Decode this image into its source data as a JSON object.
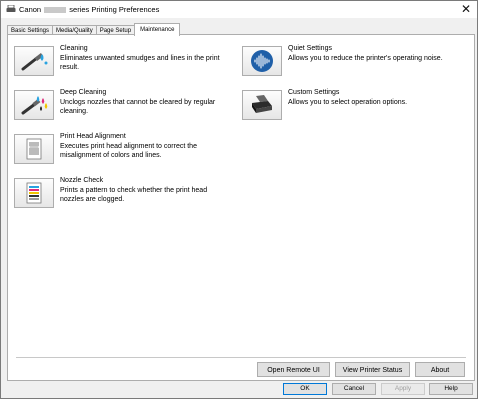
{
  "window": {
    "title_prefix": "Canon",
    "title_suffix": "series Printing Preferences",
    "close_glyph": "✕"
  },
  "tabs": [
    {
      "label": "Basic Settings"
    },
    {
      "label": "Media/Quality"
    },
    {
      "label": "Page Setup"
    },
    {
      "label": "Maintenance"
    }
  ],
  "maintenance": {
    "cleaning": {
      "title": "Cleaning",
      "description": "Eliminates unwanted smudges and lines in the print result."
    },
    "deep_cleaning": {
      "title": "Deep Cleaning",
      "description": "Unclogs nozzles that cannot be cleared by regular cleaning."
    },
    "print_head_alignment": {
      "title": "Print Head Alignment",
      "description": "Executes print head alignment to correct the misalignment of colors and lines."
    },
    "nozzle_check": {
      "title": "Nozzle Check",
      "description": "Prints a pattern to check whether the print head nozzles are clogged."
    },
    "quiet_settings": {
      "title": "Quiet Settings",
      "description": "Allows you to reduce the printer's operating noise."
    },
    "custom_settings": {
      "title": "Custom Settings",
      "description": "Allows you to select operation options."
    }
  },
  "panel_buttons": {
    "open_remote_ui": "Open Remote UI",
    "view_printer_status": "View Printer Status",
    "about": "About"
  },
  "dialog_buttons": {
    "ok": "OK",
    "cancel": "Cancel",
    "apply": "Apply",
    "help": "Help"
  },
  "colors": {
    "accent": "#0078d7",
    "quiet_icon": "#1f5fa8"
  },
  "icons": {
    "cleaning": "cleaning-icon",
    "deep_cleaning": "deep-cleaning-icon",
    "print_head_alignment": "alignment-pattern-icon",
    "nozzle_check": "nozzle-check-pattern-icon",
    "quiet_settings": "sound-wave-icon",
    "custom_settings": "printer-icon"
  }
}
